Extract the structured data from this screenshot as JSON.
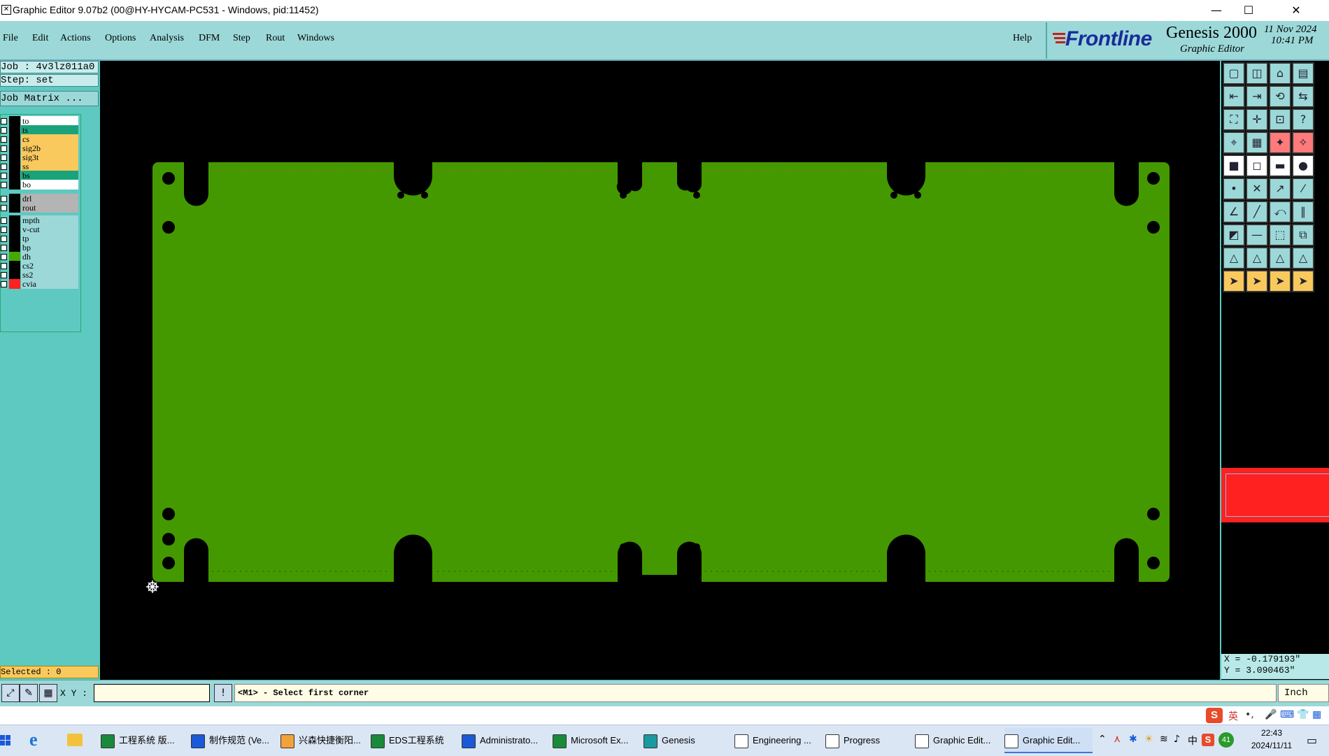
{
  "window": {
    "title": "Graphic Editor 9.07b2 (00@HY-HYCAM-PC531 - Windows, pid:11452)",
    "app_icon": "genesis-icon"
  },
  "menu": [
    "File",
    "Edit",
    "Actions",
    "Options",
    "Analysis",
    "DFM",
    "Step",
    "Rout",
    "Windows"
  ],
  "help": "Help",
  "brand": {
    "logo": "Frontline",
    "product": "Genesis 2000",
    "subtitle": "Graphic Editor",
    "date": "11 Nov 2024",
    "time": "10:41 PM"
  },
  "job": {
    "job_line": "Job : 4v3lz011a0",
    "step_line": "Step: set",
    "matrix_button": "Job Matrix ..."
  },
  "layers": [
    {
      "name": "to",
      "color": "#ffffff"
    },
    {
      "name": "ts",
      "color": "#1aa37a"
    },
    {
      "name": "cs",
      "color": "#f9c95e"
    },
    {
      "name": "sig2b",
      "color": "#f9c95e"
    },
    {
      "name": "sig3t",
      "color": "#f9c95e"
    },
    {
      "name": "ss",
      "color": "#f9c95e"
    },
    {
      "name": "bs",
      "color": "#1aa37a"
    },
    {
      "name": "bo",
      "color": "#ffffff"
    },
    {
      "name": "drl",
      "color": "#b4b4b4"
    },
    {
      "name": "rout",
      "color": "#b4b4b4"
    },
    {
      "name": "mpth",
      "color": "#9cd8d8"
    },
    {
      "name": "v-cut",
      "color": "#9cd8d8"
    },
    {
      "name": "tp",
      "color": "#9cd8d8"
    },
    {
      "name": "bp",
      "color": "#9cd8d8"
    },
    {
      "name": "dh",
      "color": "#9cd8d8"
    },
    {
      "name": "cs2",
      "color": "#9cd8d8"
    },
    {
      "name": "ss2",
      "color": "#9cd8d8"
    },
    {
      "name": "cvia",
      "color": "#9cd8d8"
    }
  ],
  "selected": "Selected : 0",
  "coords": {
    "x": "X = -0.179193\"",
    "y": "Y = 3.090463\""
  },
  "command": {
    "xy_label": "X Y :",
    "xy_value": "",
    "prompt": "<M1> - Select first corner",
    "unit": "Inch"
  },
  "taskbar": {
    "tasks": [
      "工程系统 版...",
      "制作规范 (Ve...",
      "兴森快捷衡阳...",
      "EDS工程系统",
      "Administrato...",
      "Microsoft Ex...",
      "Genesis",
      "Engineering ...",
      "Progress",
      "Graphic Edit...",
      "Graphic Edit..."
    ],
    "ime": "中",
    "badge": "41",
    "clock_time": "22:43",
    "clock_date": "2024/11/11"
  },
  "colors": {
    "board": "#449900",
    "canvas_bg": "#000000",
    "panel": "#5ec9c0",
    "menu_bg": "#9cd8d8",
    "overview": "#ff2020"
  }
}
